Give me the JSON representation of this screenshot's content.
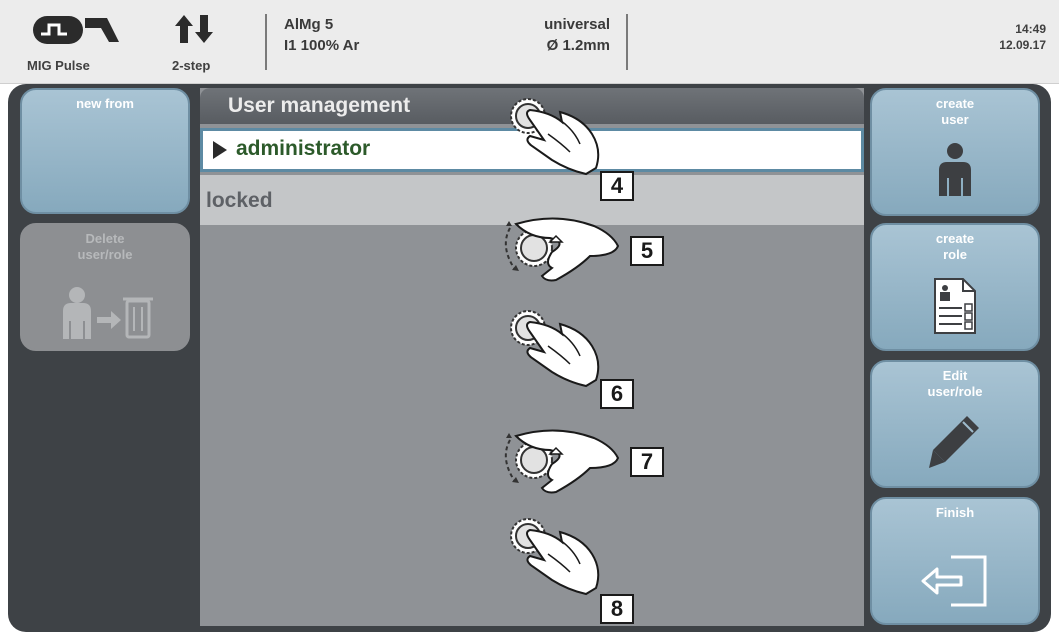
{
  "status_bar": {
    "process": "MIG Pulse",
    "mode": "2-step",
    "material": "AlMg 5",
    "gas": "I1 100% Ar",
    "characteristic": "universal",
    "wire_diameter": "Ø  1.2mm",
    "time": "14:49",
    "date": "12.09.17"
  },
  "left_buttons": {
    "new_from": "new from",
    "delete": "Delete\nuser/role"
  },
  "right_buttons": {
    "create_user": "create\nuser",
    "create_role": "create\nrole",
    "edit": "Edit\nuser/role",
    "finish": "Finish"
  },
  "panel": {
    "title": "User management",
    "items": [
      {
        "label": "administrator",
        "selected": true
      },
      {
        "label": "locked",
        "selected": false
      }
    ]
  },
  "steps": [
    "4",
    "5",
    "6",
    "7",
    "8"
  ],
  "colors": {
    "button_blue": "#9dbacb",
    "button_disabled": "#8d8f92",
    "selected_text": "#2c5a2a",
    "selection_border": "#5d8aa3"
  }
}
